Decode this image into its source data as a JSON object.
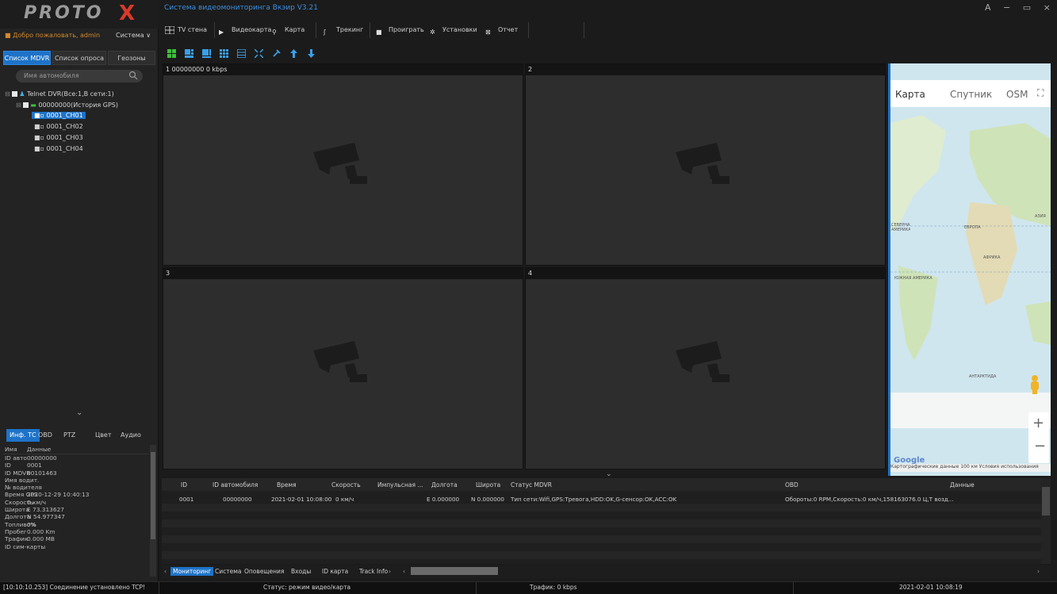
{
  "app": {
    "logo_text": "PROTO",
    "logo_mark": "X",
    "title": "Система видеомониторинга Вкэир V3.21",
    "window_buttons": "A − ▭ ×"
  },
  "header": {
    "welcome": "Добро пожаловать, admin",
    "system_menu": "Система ∨"
  },
  "toolbar": {
    "items": [
      "TV стена",
      "Видеокарта",
      "Карта",
      "Трекинг",
      "Проиграть",
      "Установки",
      "Отчет"
    ]
  },
  "left_tabs": [
    "Список MDVR",
    "Список опроса",
    "Геозоны"
  ],
  "search": {
    "placeholder": "Имя автомобиля"
  },
  "tree": {
    "root": "Telnet DVR(Все:1,В сети:1)",
    "vehicle": "00000000(История GPS)",
    "channels": [
      "0001_CH01",
      "0001_CH02",
      "0001_CH03",
      "0001_CH04"
    ]
  },
  "info_tabs": [
    "Инф. ТС",
    "OBD",
    "PTZ",
    "Цвет",
    "Аудио"
  ],
  "info_table": {
    "headers": [
      "Имя",
      "Данные"
    ],
    "rows": [
      [
        "ID авто",
        "00000000"
      ],
      [
        "ID",
        "0001"
      ],
      [
        "ID MDVR",
        "00101463"
      ],
      [
        "Имя водит.",
        ""
      ],
      [
        "№ водителя",
        ""
      ],
      [
        "Время GPS",
        "2020-12-29 10:40:13"
      ],
      [
        "Скорость",
        "0 км/ч"
      ],
      [
        "Широта",
        "E 73.313627"
      ],
      [
        "Долгота",
        "N 54.977347"
      ],
      [
        "Топливо%",
        "0%"
      ],
      [
        "Пробег",
        "0.000 Km"
      ],
      [
        "Трафик",
        "0.000 MB"
      ],
      [
        "ID сим-карты",
        ""
      ]
    ]
  },
  "video_panes": [
    {
      "label": "1 00000000  0 kbps"
    },
    {
      "label": "2"
    },
    {
      "label": "3"
    },
    {
      "label": "4"
    }
  ],
  "map": {
    "tabs": [
      "Карта",
      "Спутник",
      "OSM"
    ],
    "labels": [
      "ЕВРОПА",
      "АФРИКА",
      "ЮЖНАЯ АМЕРИКА",
      "АНТАРКТИДА",
      "АЗИЯ",
      "СЕВЕРНАЯ АМЕРИКА"
    ],
    "google": "Google",
    "copyright": "Картографические данные   100 км   Условия использования"
  },
  "bottom_table": {
    "headers": [
      "ID",
      "ID автомобиля",
      "Время",
      "Скорость",
      "Импульсная ...",
      "Долгота",
      "Широта",
      "Статус MDVR",
      "OBD",
      "Данные"
    ],
    "rows": [
      [
        "0001",
        "00000000",
        "2021-02-01 10:08:00",
        "0 км/ч",
        "",
        "E 0.000000",
        "N 0.000000",
        "Тип сети:Wifi,GPS:Тревога,HDD:OK,G-сенсор:OK,ACC:OK",
        "Обороты:0 RPM,Скорость:0 км/ч,158163076.0 Ц,T возд...",
        ""
      ]
    ]
  },
  "bottom_tabs": [
    "Мониторинг",
    "Система",
    "Оповещения",
    "Входы",
    "ID карта",
    "Track Info"
  ],
  "status_bar": {
    "log": "[10:10:10.253] Соединение установлено TCP!",
    "mode": "Статус: режим видео/карта",
    "traffic": "Трафик: 0 kbps",
    "clock": "2021-02-01 10:08:19"
  },
  "colors": {
    "accent": "#1e73c8",
    "title": "#3a8fe0",
    "logo_x": "#d93a2a"
  }
}
